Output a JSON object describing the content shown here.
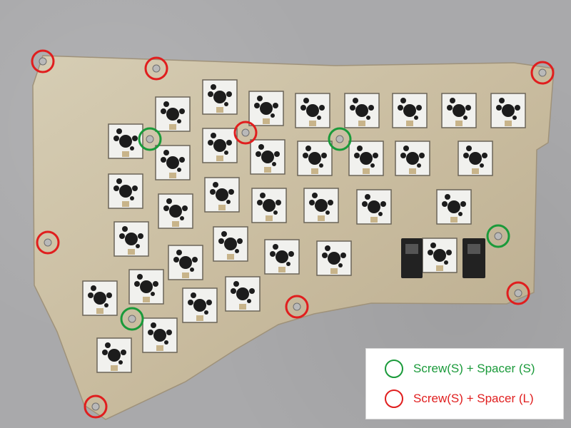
{
  "colors": {
    "background": "#a9a9ab",
    "plate": "#cbbfa3",
    "switch": "#f1f1ee",
    "green_marker": "#1a9a3a",
    "red_marker": "#e01e1e"
  },
  "legend": {
    "small_label": "Screw(S)  + Spacer (S)",
    "large_label": "Screw(S) + Spacer (L)",
    "small_color": "#1a9a3a",
    "large_color": "#e01e1e"
  },
  "markers": {
    "green_count": 4,
    "red_count": 8
  }
}
